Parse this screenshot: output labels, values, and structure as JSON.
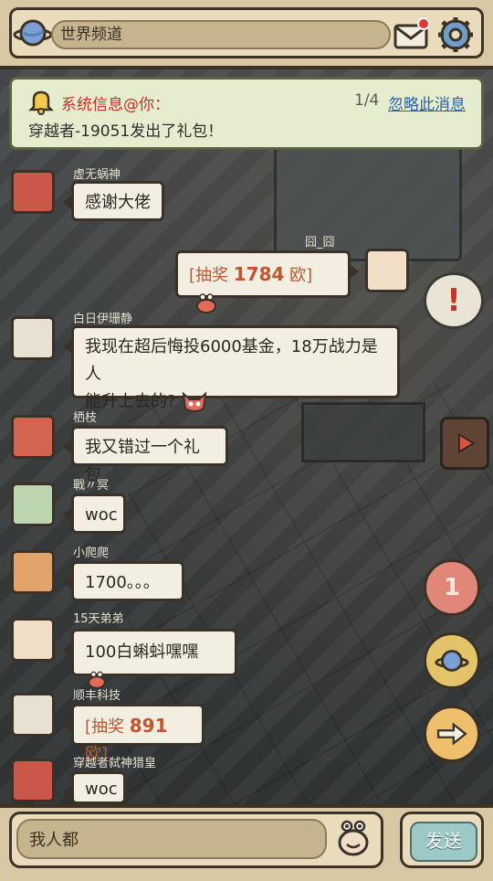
{
  "header": {
    "search_placeholder": "世界频道"
  },
  "system_message": {
    "title": "系统信息@你：",
    "page": "1/4",
    "ignore_label": "忽略此消息",
    "text": "穿越者-19051发出了礼包！"
  },
  "messages": [
    {
      "name": "虚无蜗神",
      "text": "感谢大佬"
    },
    {
      "name": "囧_囧",
      "prefix": "[抽奖 ",
      "amount": "1784",
      "suffix": " 欧]"
    },
    {
      "name": "白日伊珊静",
      "line1": "我现在超后悔投6000基金，18万战力是人",
      "line2": "能升上去的?"
    },
    {
      "name": "栖枝",
      "text": "我又错过一个礼包"
    },
    {
      "name": "戰〃冥",
      "text": "woc"
    },
    {
      "name": "小爬爬",
      "text": "1700。。。"
    },
    {
      "name": "15天弟弟",
      "text": "100白蝌蚪嘿嘿"
    },
    {
      "name": "顺丰科技",
      "prefix": "[抽奖 ",
      "amount": "891",
      "suffix": " 欧]"
    },
    {
      "name": "穿越者弑神猎皇",
      "text": "woc"
    }
  ],
  "side_buttons": {
    "badge_count": "1"
  },
  "footer": {
    "input_value": "我人都",
    "send_label": "发送"
  },
  "colors": {
    "accent_red": "#c9302a",
    "link_blue": "#2a5fb0",
    "lottery_orange": "#c0552f",
    "panel_beige": "#e9dcbc"
  }
}
